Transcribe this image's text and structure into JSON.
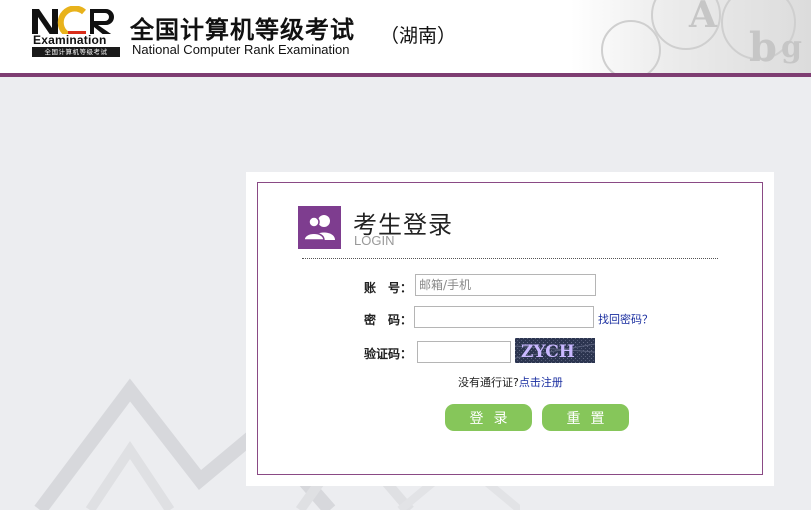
{
  "header": {
    "logo_text": "NCR",
    "logo_word": "Examination",
    "logo_sub": "全国计算机等级考试",
    "title": "全国计算机等级考试",
    "subtitle": "National Computer Rank Examination",
    "region": "（湖南）"
  },
  "colors": {
    "brand_purple": "#7e3d72",
    "icon_purple": "#7e3d8f",
    "button_green": "#86c65a",
    "link_blue": "#1a2ea0"
  },
  "login": {
    "title": "考生登录",
    "subtitle": "LOGIN",
    "icon": "users-icon",
    "account_label": "账　号：",
    "account_placeholder": "邮箱/手机",
    "account_value": "",
    "password_label": "密　码：",
    "password_value": "",
    "forgot_link": "找回密码？",
    "captcha_label": "验证码：",
    "captcha_value": "",
    "captcha_text": "ZYCH",
    "register_prompt": "没有通行证?",
    "register_link": "点击注册",
    "login_button": "登录",
    "reset_button": "重置"
  }
}
